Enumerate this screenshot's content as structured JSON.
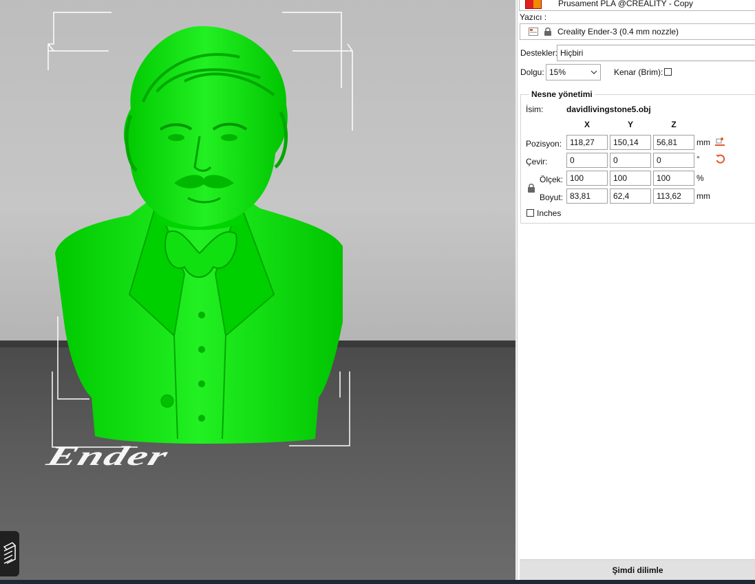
{
  "viewport": {
    "bed_logo_text": "Ender",
    "model_color": "#00e600",
    "icons": [
      "layers-icon"
    ]
  },
  "sidebar": {
    "material": {
      "value": "Prusament PLA @CREALITY - Copy",
      "swatch_colors": [
        "#e02020",
        "#f08a00"
      ]
    },
    "printer": {
      "label": "Yazıcı :",
      "value": "Creality Ender-3 (0.4 mm nozzle)",
      "icons": [
        "printer-icon",
        "lock-icon"
      ]
    },
    "supports": {
      "label": "Destekler:",
      "value": "Hiçbiri"
    },
    "infill": {
      "label": "Dolgu:",
      "value": "15%"
    },
    "brim": {
      "label": "Kenar (Brim):",
      "checked": false
    },
    "object_manipulation": {
      "title": "Nesne yönetimi",
      "name_label": "İsim:",
      "name_value": "davidlivingstone5.obj",
      "axes": [
        "X",
        "Y",
        "Z"
      ],
      "position": {
        "label": "Pozisyon:",
        "values": [
          "118,27",
          "150,14",
          "56,81"
        ],
        "unit": "mm"
      },
      "rotation": {
        "label": "Çevir:",
        "values": [
          "0",
          "0",
          "0"
        ],
        "unit": "°"
      },
      "scale": {
        "label": "Ölçek:",
        "values": [
          "100",
          "100",
          "100"
        ],
        "unit": "%"
      },
      "size": {
        "label": "Boyut:",
        "values": [
          "83,81",
          "62,4",
          "113,62"
        ],
        "unit": "mm"
      },
      "inches": {
        "label": "Inches",
        "checked": false
      }
    },
    "slice_button": "Şimdi dilimle"
  }
}
